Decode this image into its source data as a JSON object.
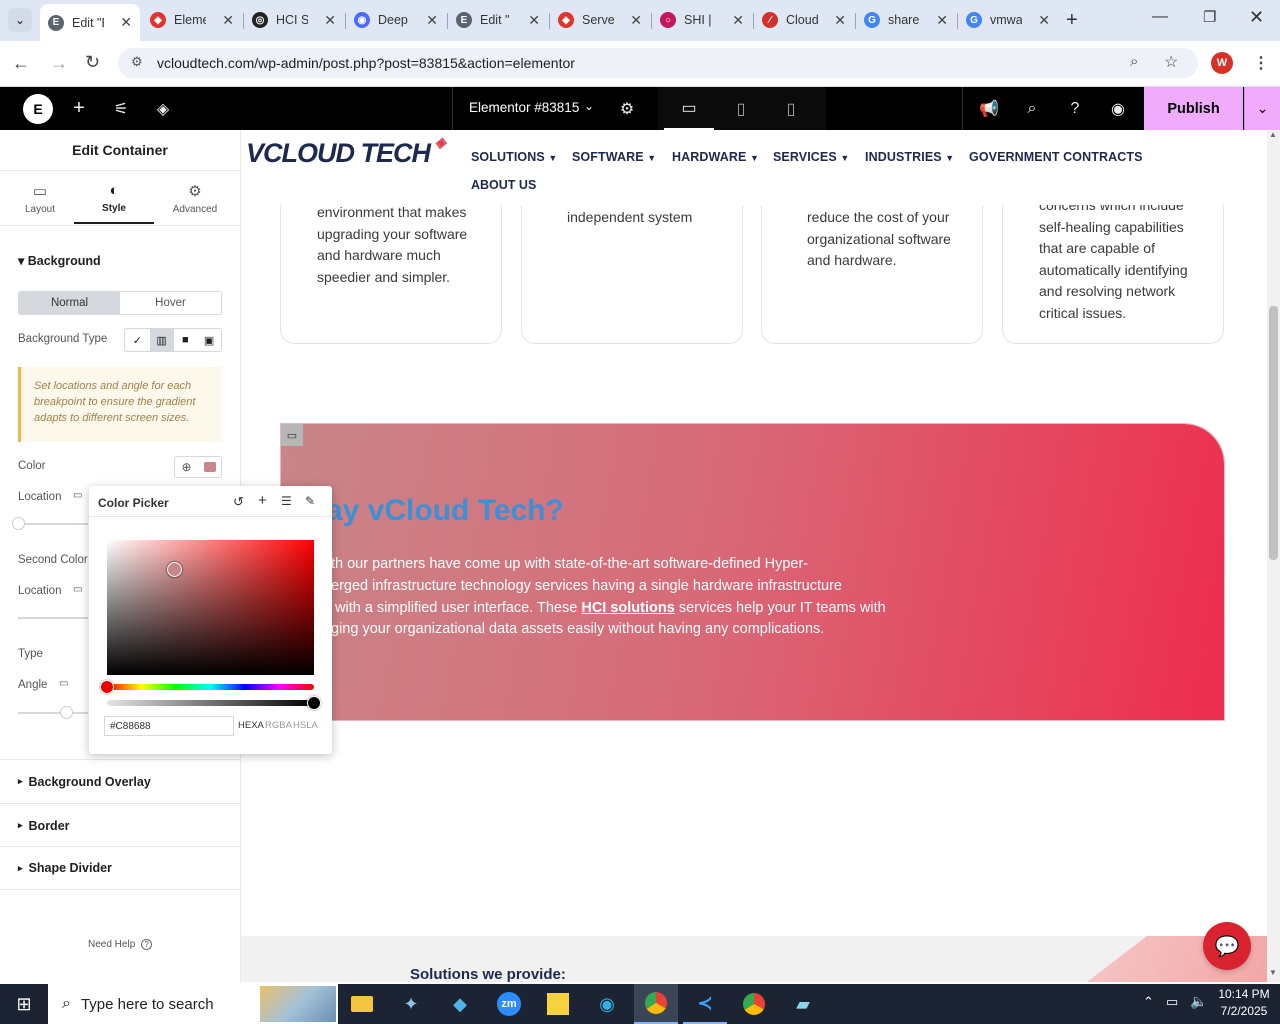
{
  "browser": {
    "tabs": [
      {
        "title": "Edit \"E",
        "fav": "E",
        "favColor": "#5b6470",
        "active": true
      },
      {
        "title": "Eleme",
        "fav": "◆",
        "favColor": "#e0352b"
      },
      {
        "title": "HCI S",
        "fav": "◎",
        "favColor": "#222"
      },
      {
        "title": "Deep",
        "fav": "◉",
        "favColor": "#4d6bfe"
      },
      {
        "title": "Edit \"",
        "fav": "E",
        "favColor": "#5b6470"
      },
      {
        "title": "Serve",
        "fav": "◆",
        "favColor": "#e0352b"
      },
      {
        "title": "SHI |",
        "fav": "○",
        "favColor": "#c2185b"
      },
      {
        "title": "Cloud",
        "fav": "∕",
        "favColor": "#d32f2f"
      },
      {
        "title": "share",
        "fav": "G",
        "favColor": "#4285f4"
      },
      {
        "title": "vmwa",
        "fav": "G",
        "favColor": "#4285f4"
      }
    ],
    "url": "vcloudtech.com/wp-admin/post.php?post=83815&action=elementor",
    "profile_initial": "W"
  },
  "elementor": {
    "doc_title": "Elementor #83815",
    "publish_label": "Publish",
    "panel_title": "Edit Container",
    "tabs": [
      {
        "label": "Layout",
        "icon": "▭"
      },
      {
        "label": "Style",
        "icon": "◐"
      },
      {
        "label": "Advanced",
        "icon": "⚙"
      }
    ],
    "background": {
      "section_label": "Background",
      "normal_label": "Normal",
      "hover_label": "Hover",
      "type_label": "Background Type",
      "notice": "Set locations and angle for each breakpoint to ensure the gradient adapts to different screen sizes.",
      "color_label": "Color",
      "location_label": "Location",
      "second_color_label": "Second Color",
      "location2_label": "Location",
      "type2_label": "Type",
      "angle_label": "Angle"
    },
    "sections": [
      "Background Overlay",
      "Border",
      "Shape Divider"
    ],
    "need_help": "Need Help"
  },
  "color_picker": {
    "title": "Color Picker",
    "hex_value": "#C88688",
    "formats": [
      "HEXA",
      "RGBA",
      "HSLA"
    ],
    "colors": {
      "hue": "#ff0000",
      "selected": "#c88688"
    }
  },
  "site": {
    "logo_text": "VCLOUD TECH",
    "menu": [
      "SOLUTIONS",
      "SOFTWARE",
      "HARDWARE",
      "SERVICES",
      "INDUSTRIES",
      "GOVERNMENT CONTRACTS",
      "ABOUT US"
    ],
    "cards": [
      "environment that makes upgrading your software and hardware much speedier and simpler.",
      "independent system",
      "reduce the cost of your organizational software and hardware.",
      "concerns which include self-healing capabilities that are capable of automatically identifying and resolving network critical issues."
    ],
    "banner_heading": "ay vCloud Tech?",
    "banner_text_1": "th our partners have come up with state-of-the-art software-defined Hyper-",
    "banner_text_2": "erged infrastructure technology services having a single hardware infrastructure",
    "banner_text_3a": "with a simplified user interface. These ",
    "banner_link": "HCI solutions",
    "banner_text_3b": " services help your IT teams with",
    "banner_text_4": "ging your organizational data assets easily without having any complications.",
    "solutions_heading": "Solutions we provide:"
  },
  "taskbar": {
    "search_placeholder": "Type here to search",
    "time": "10:14 PM",
    "date": "7/2/2025"
  }
}
